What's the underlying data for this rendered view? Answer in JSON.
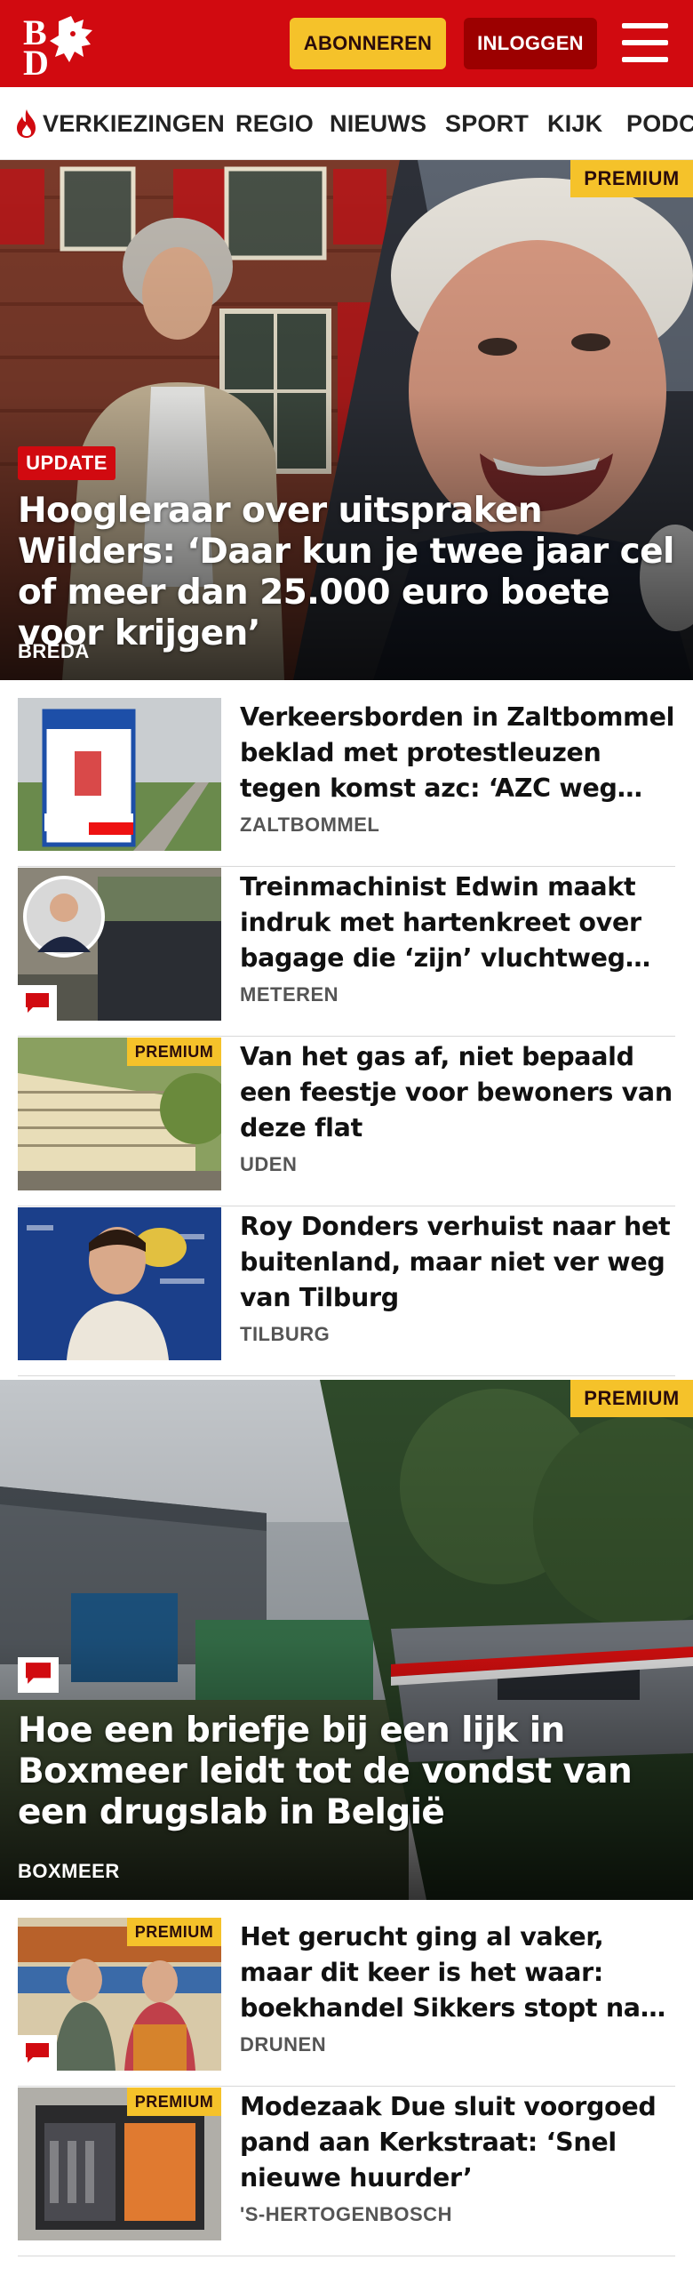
{
  "header": {
    "logo_text": "BD",
    "subscribe_label": "ABONNEREN",
    "login_label": "INLOGGEN",
    "menu_icon": "hamburger-menu-icon",
    "brand_color": "#d10a10",
    "accent_color": "#f5c22a"
  },
  "nav": {
    "items": [
      {
        "label": "VERKIEZINGEN",
        "icon": "flame-icon"
      },
      {
        "label": "REGIO"
      },
      {
        "label": "NIEUWS"
      },
      {
        "label": "SPORT"
      },
      {
        "label": "KIJK"
      },
      {
        "label": "PODCAST"
      }
    ]
  },
  "hero1": {
    "premium_label": "PREMIUM",
    "update_label": "UPDATE",
    "title": "Hoogleraar over uitspraken Wilders: ‘Daar kun je twee jaar cel of meer dan 25.000 euro boete voor krijgen’",
    "location": "BREDA"
  },
  "list1": [
    {
      "title": "Verkeersborden in Zaltbommel beklad met protestleuzen tegen komst azc: ‘AZC weg ermee’",
      "location": "ZALTBOMMEL",
      "premium": false,
      "comments": false
    },
    {
      "title": "Treinmachinist Edwin maakt indruk met hartenkreet over bagage die ‘zijn’ vluchtweg blokkeert",
      "location": "METEREN",
      "premium": false,
      "comments": true
    },
    {
      "title": "Van het gas af, niet bepaald een feestje voor bewoners van deze flat",
      "location": "UDEN",
      "premium": true,
      "comments": false
    },
    {
      "title": "Roy Donders verhuist naar het buitenland, maar niet ver weg van Tilburg",
      "location": "TILBURG",
      "premium": false,
      "comments": false
    }
  ],
  "hero2": {
    "premium_label": "PREMIUM",
    "title": "Hoe een briefje bij een lijk in Boxmeer leidt tot de vondst van een drugslab in België",
    "location": "BOXMEER"
  },
  "list2": [
    {
      "title": "Het gerucht ging al vaker, maar dit keer is het waar: boekhandel Sikkers stopt na meer dan een eeuw",
      "location": "DRUNEN",
      "premium": true,
      "comments": true
    },
    {
      "title": "Modezaak Due sluit voorgoed pand aan Kerkstraat: ‘Snel nieuwe huurder’",
      "location": "'S-HERTOGENBOSCH",
      "premium": true,
      "comments": false
    }
  ],
  "labels": {
    "premium": "PREMIUM"
  }
}
